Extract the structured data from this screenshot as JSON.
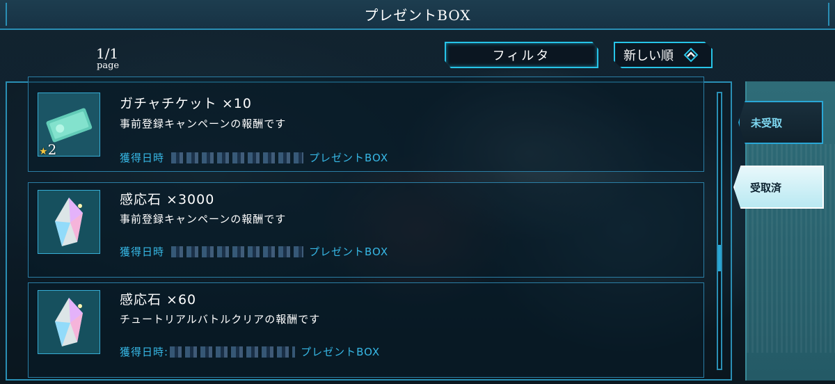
{
  "header": {
    "title": "プレゼントBOX"
  },
  "pagination": {
    "current": "1/1",
    "label": "page"
  },
  "controls": {
    "filter_label": "フィルタ",
    "sort_label": "新しい順",
    "sort_icon": "chevron-up-diamond-icon"
  },
  "tabs": [
    {
      "label": "未受取",
      "selected": false
    },
    {
      "label": "受取済",
      "selected": true
    }
  ],
  "items": [
    {
      "name": "ガチャチケット ×10",
      "description": "事前登録キャンペーンの報酬です",
      "date_label": "獲得日時",
      "source": "プレゼントBOX",
      "icon": "gacha-ticket-icon",
      "star_count": "2"
    },
    {
      "name": "感応石 ×3000",
      "description": "事前登録キャンペーンの報酬です",
      "date_label": "獲得日時",
      "source": "プレゼントBOX",
      "icon": "crystal-icon"
    },
    {
      "name": "感応石 ×60",
      "description": "チュートリアルバトルクリアの報酬です",
      "date_label": "獲得日時:",
      "source": "プレゼントBOX",
      "icon": "crystal-icon"
    }
  ],
  "colors": {
    "accent": "#27c4e8",
    "frame": "#2a8fb5",
    "footer_text": "#37b8e6"
  }
}
